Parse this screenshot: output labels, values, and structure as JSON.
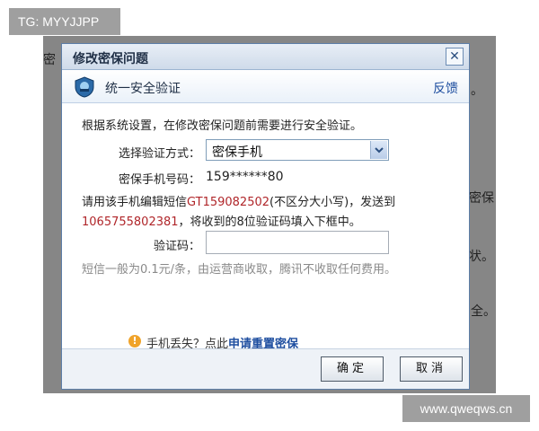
{
  "watermark": {
    "top_tag": "TG: MYYJJPP",
    "bottom_tag": "www.qweqws.cn"
  },
  "background": {
    "fragments": [
      "密",
      "。",
      "密保",
      "状。",
      "全。"
    ]
  },
  "dialog": {
    "title": "修改密保问题",
    "close_icon": "close-icon",
    "header": {
      "icon": "shield-icon",
      "title": "统一安全验证",
      "feedback": "反馈"
    },
    "intro": "根据系统设置，在修改密保问题前需要进行安全验证。",
    "method": {
      "label": "选择验证方式：",
      "selected": "密保手机"
    },
    "phone": {
      "label": "密保手机号码：",
      "value": "159******80"
    },
    "sms": {
      "part1": "请用该手机编辑短信",
      "code": "GT159082502",
      "part2": "(不区分大小写)，发送到",
      "number": "1065755802381",
      "part3": "，将收到的8位验证码填入下框中。"
    },
    "code_field": {
      "label": "验证码：",
      "value": ""
    },
    "fee_note": "短信一般为0.1元/条，由运营商收取，腾讯不收取任何费用。",
    "lost_phone": {
      "icon": "warning-icon",
      "text": "手机丢失？点此",
      "link": "申请重置密保"
    },
    "buttons": {
      "ok": "确定",
      "cancel": "取消"
    }
  }
}
